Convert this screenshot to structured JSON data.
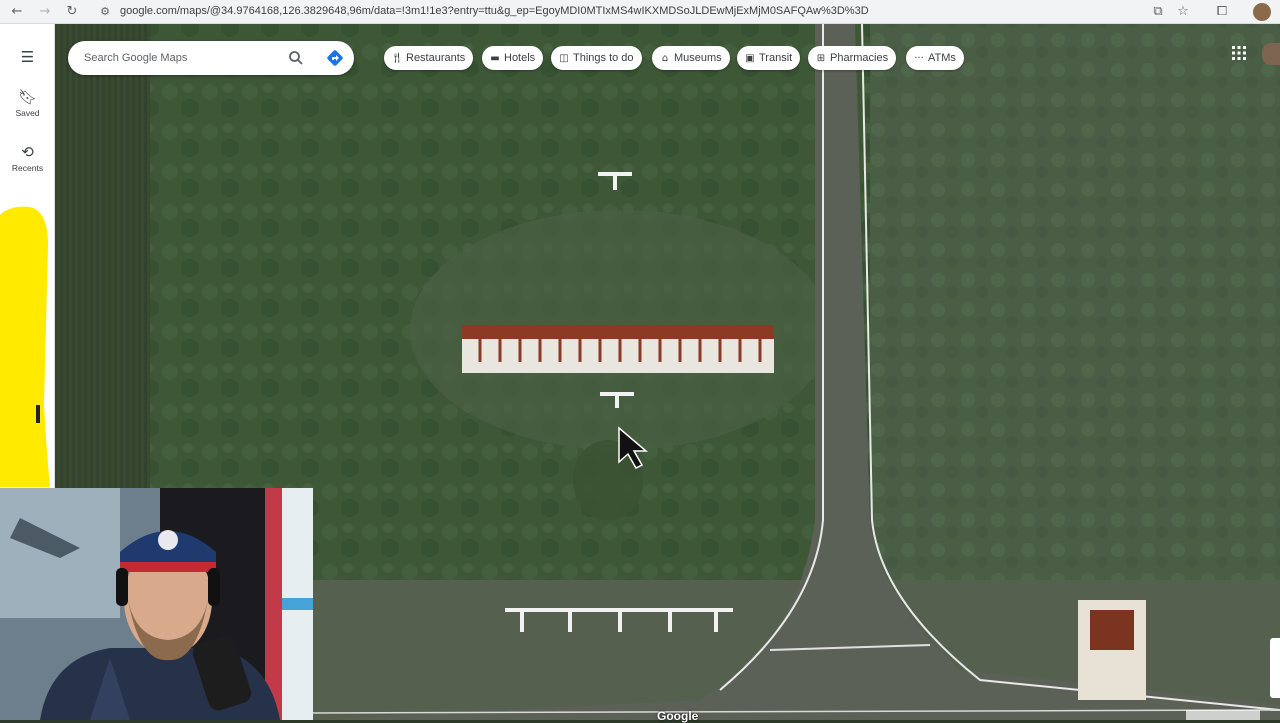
{
  "browser": {
    "url": "google.com/maps/@34.9764168,126.3829648,96m/data=!3m1!1e3?entry=ttu&g_ep=EgoyMDI0MTIxMS4wIKXMDSoJLDEwMjExMjM0SAFQAw%3D%3D"
  },
  "sidebar": {
    "saved_label": "Saved",
    "recents_label": "Recents"
  },
  "search": {
    "placeholder": "Search Google Maps"
  },
  "chips": [
    {
      "label": "Restaurants",
      "icon": "fork-knife-icon"
    },
    {
      "label": "Hotels",
      "icon": "bed-icon"
    },
    {
      "label": "Things to do",
      "icon": "camera-icon"
    },
    {
      "label": "Museums",
      "icon": "museum-icon"
    },
    {
      "label": "Transit",
      "icon": "train-icon"
    },
    {
      "label": "Pharmacies",
      "icon": "pharmacy-icon"
    },
    {
      "label": "ATMs",
      "icon": "atm-icon"
    }
  ],
  "map": {
    "attribution": "Google"
  },
  "colors": {
    "accent_blue": "#1a73e8",
    "annotation_yellow": "#ffea00"
  }
}
